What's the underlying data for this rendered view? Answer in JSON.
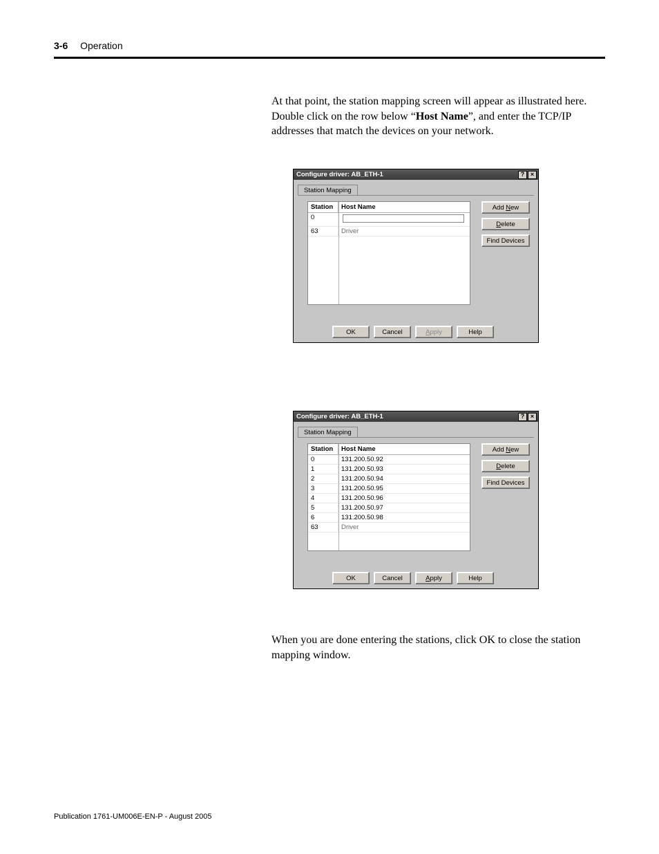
{
  "header": {
    "page_number": "3-6",
    "section": "Operation"
  },
  "paragraphs": {
    "p1_a": "At that point, the station mapping screen will appear as illustrated here. Double click on the row below “",
    "p1_hn": "Host Name",
    "p1_b": "”, and enter the TCP/IP addresses that match the devices on your network.",
    "p2": "When you are done entering the stations, click OK to close the station mapping window."
  },
  "dialog": {
    "title": "Configure driver: AB_ETH-1",
    "help_glyph": "?",
    "close_glyph": "×",
    "tab_label": "Station Mapping",
    "columns": {
      "station": "Station",
      "host": "Host Name"
    },
    "rows_initial": [
      {
        "station": "0",
        "host": ""
      },
      {
        "station": "63",
        "host": "Driver"
      }
    ],
    "rows_filled": [
      {
        "station": "0",
        "host": "131.200.50.92"
      },
      {
        "station": "1",
        "host": "131.200.50.93"
      },
      {
        "station": "2",
        "host": "131.200.50.94"
      },
      {
        "station": "3",
        "host": "131.200.50.95"
      },
      {
        "station": "4",
        "host": "131.200.50.96"
      },
      {
        "station": "5",
        "host": "131.200.50.97"
      },
      {
        "station": "6",
        "host": "131.200.50.98"
      },
      {
        "station": "63",
        "host": "Driver"
      }
    ],
    "btn_add_a": "Add ",
    "btn_add_u": "N",
    "btn_add_b": "ew",
    "btn_del_u": "D",
    "btn_del_b": "elete",
    "btn_find": "Find Devices",
    "btn_ok": "OK",
    "btn_cancel": "Cancel",
    "btn_apply_u": "A",
    "btn_apply_b": "pply",
    "btn_help": "Help"
  },
  "footer": "Publication 1761-UM006E-EN-P - August 2005"
}
